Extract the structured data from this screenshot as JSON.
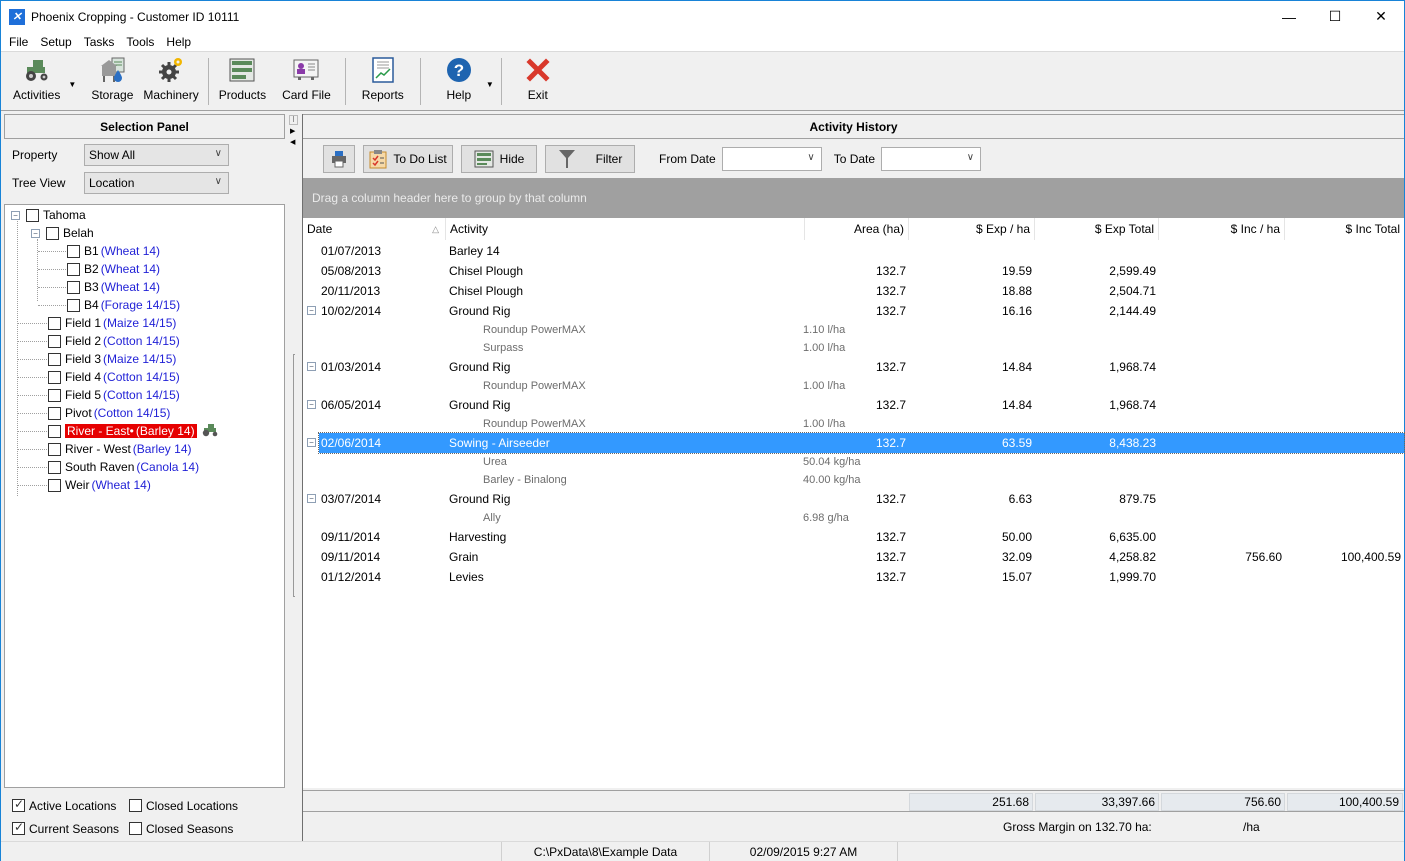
{
  "window": {
    "title": "Phoenix Cropping - Customer ID 10111",
    "controls": [
      "minimize",
      "maximize",
      "close"
    ]
  },
  "menu": [
    "File",
    "Setup",
    "Tasks",
    "Tools",
    "Help"
  ],
  "toolbar": {
    "activities": "Activities",
    "storage": "Storage",
    "machinery": "Machinery",
    "products": "Products",
    "card_file": "Card File",
    "reports": "Reports",
    "help": "Help",
    "exit": "Exit"
  },
  "selection_panel": {
    "title": "Selection Panel",
    "property_label": "Property",
    "property_value": "Show All",
    "tree_view_label": "Tree View",
    "tree_view_value": "Location",
    "tree": {
      "root": "Tahoma",
      "group": "Belah",
      "items": [
        {
          "name": "B1",
          "crop": "(Wheat 14)"
        },
        {
          "name": "B2",
          "crop": "(Wheat 14)"
        },
        {
          "name": "B3",
          "crop": "(Wheat 14)"
        },
        {
          "name": "B4",
          "crop": "(Forage 14/15)"
        },
        {
          "name": "Field 1",
          "crop": "(Maize 14/15)"
        },
        {
          "name": "Field 2",
          "crop": "(Cotton 14/15)"
        },
        {
          "name": "Field 3",
          "crop": "(Maize 14/15)"
        },
        {
          "name": "Field 4",
          "crop": "(Cotton 14/15)"
        },
        {
          "name": "Field 5",
          "crop": "(Cotton 14/15)"
        },
        {
          "name": "Pivot",
          "crop": "(Cotton 14/15)"
        },
        {
          "name": "River - East•",
          "crop": "(Barley 14)",
          "highlighted": true
        },
        {
          "name": "River - West",
          "crop": "(Barley 14)"
        },
        {
          "name": "South Raven",
          "crop": "(Canola 14)"
        },
        {
          "name": "Weir",
          "crop": "(Wheat 14)"
        }
      ]
    },
    "checks": {
      "active_locations": {
        "label": "Active Locations",
        "checked": true
      },
      "closed_locations": {
        "label": "Closed Locations",
        "checked": false
      },
      "current_seasons": {
        "label": "Current Seasons",
        "checked": true
      },
      "closed_seasons": {
        "label": "Closed Seasons",
        "checked": false
      }
    }
  },
  "activity_history": {
    "title": "Activity History",
    "buttons": {
      "todo": "To Do List",
      "hide": "Hide",
      "filter": "Filter"
    },
    "from_date_label": "From Date",
    "from_date_value": "",
    "to_date_label": "To Date",
    "to_date_value": "",
    "group_hint": "Drag a column header here to group by that column",
    "columns": [
      "Date",
      "Activity",
      "Area (ha)",
      "$ Exp / ha",
      "$ Exp Total",
      "$ Inc / ha",
      "$ Inc Total"
    ],
    "rows": [
      {
        "type": "main",
        "date": "01/07/2013",
        "activity": "Barley 14",
        "area": "",
        "exp_ha": "",
        "exp_total": "",
        "inc_ha": "",
        "inc_total": ""
      },
      {
        "type": "main",
        "date": "05/08/2013",
        "activity": "Chisel Plough",
        "area": "132.7",
        "exp_ha": "19.59",
        "exp_total": "2,599.49",
        "inc_ha": "",
        "inc_total": ""
      },
      {
        "type": "main",
        "date": "20/11/2013",
        "activity": "Chisel Plough",
        "area": "132.7",
        "exp_ha": "18.88",
        "exp_total": "2,504.71",
        "inc_ha": "",
        "inc_total": ""
      },
      {
        "type": "main",
        "expand": true,
        "date": "10/02/2014",
        "activity": "Ground Rig",
        "area": "132.7",
        "exp_ha": "16.16",
        "exp_total": "2,144.49",
        "inc_ha": "",
        "inc_total": ""
      },
      {
        "type": "sub",
        "product": "Roundup PowerMAX",
        "rate": "1.10 l/ha"
      },
      {
        "type": "sub",
        "product": "Surpass",
        "rate": "1.00 l/ha"
      },
      {
        "type": "main",
        "expand": true,
        "date": "01/03/2014",
        "activity": "Ground Rig",
        "area": "132.7",
        "exp_ha": "14.84",
        "exp_total": "1,968.74",
        "inc_ha": "",
        "inc_total": ""
      },
      {
        "type": "sub",
        "product": "Roundup PowerMAX",
        "rate": "1.00 l/ha"
      },
      {
        "type": "main",
        "expand": true,
        "date": "06/05/2014",
        "activity": "Ground Rig",
        "area": "132.7",
        "exp_ha": "14.84",
        "exp_total": "1,968.74",
        "inc_ha": "",
        "inc_total": ""
      },
      {
        "type": "sub",
        "product": "Roundup PowerMAX",
        "rate": "1.00 l/ha"
      },
      {
        "type": "main",
        "expand": true,
        "selected": true,
        "date": "02/06/2014",
        "activity": "Sowing - Airseeder",
        "area": "132.7",
        "exp_ha": "63.59",
        "exp_total": "8,438.23",
        "inc_ha": "",
        "inc_total": ""
      },
      {
        "type": "sub",
        "product": "Urea",
        "rate": "50.04 kg/ha"
      },
      {
        "type": "sub",
        "product": "Barley - Binalong",
        "rate": "40.00 kg/ha"
      },
      {
        "type": "main",
        "expand": true,
        "date": "03/07/2014",
        "activity": "Ground Rig",
        "area": "132.7",
        "exp_ha": "6.63",
        "exp_total": "879.75",
        "inc_ha": "",
        "inc_total": ""
      },
      {
        "type": "sub",
        "product": "Ally",
        "rate": "6.98 g/ha"
      },
      {
        "type": "main",
        "date": "09/11/2014",
        "activity": "Harvesting",
        "area": "132.7",
        "exp_ha": "50.00",
        "exp_total": "6,635.00",
        "inc_ha": "",
        "inc_total": ""
      },
      {
        "type": "main",
        "date": "09/11/2014",
        "activity": "Grain",
        "area": "132.7",
        "exp_ha": "32.09",
        "exp_total": "4,258.82",
        "inc_ha": "756.60",
        "inc_total": "100,400.59"
      },
      {
        "type": "main",
        "date": "01/12/2014",
        "activity": "Levies",
        "area": "132.7",
        "exp_ha": "15.07",
        "exp_total": "1,999.70",
        "inc_ha": "",
        "inc_total": ""
      }
    ],
    "totals": {
      "exp_ha": "251.68",
      "exp_total": "33,397.66",
      "inc_ha": "756.60",
      "inc_total": "100,400.59"
    },
    "gross_margin_label": "Gross Margin on 132.70 ha:",
    "gross_margin_value": "",
    "gross_margin_unit": "/ha"
  },
  "statusbar": {
    "path": "C:\\PxData\\8\\Example Data",
    "datetime": "02/09/2015  9:27 AM"
  }
}
